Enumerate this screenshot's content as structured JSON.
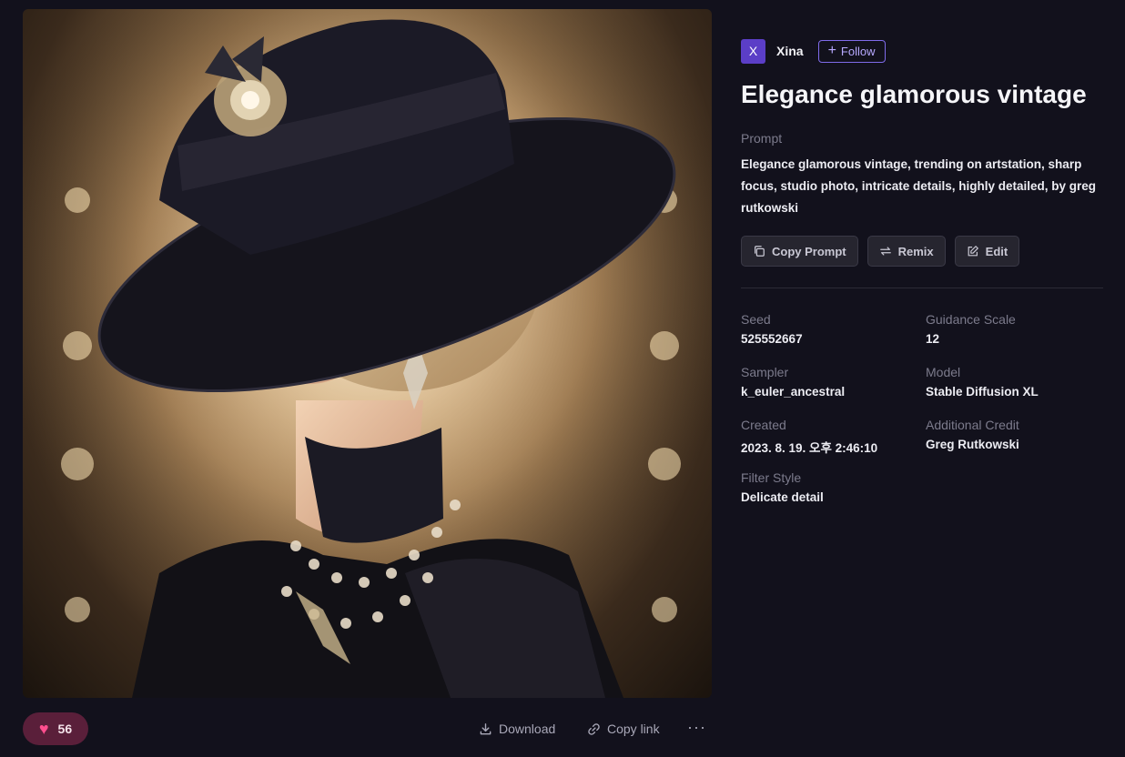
{
  "author": {
    "avatar_letter": "X",
    "name": "Xina",
    "follow_label": "Follow"
  },
  "title": "Elegance glamorous vintage",
  "prompt": {
    "label": "Prompt",
    "text": "Elegance glamorous vintage, trending on artstation, sharp focus, studio photo, intricate details, highly detailed, by greg rutkowski"
  },
  "actions": {
    "copy_prompt": "Copy Prompt",
    "remix": "Remix",
    "edit": "Edit"
  },
  "meta": {
    "seed": {
      "label": "Seed",
      "value": "525552667"
    },
    "guidance": {
      "label": "Guidance Scale",
      "value": "12"
    },
    "sampler": {
      "label": "Sampler",
      "value": "k_euler_ancestral"
    },
    "model": {
      "label": "Model",
      "value": "Stable Diffusion XL"
    },
    "created": {
      "label": "Created",
      "value": "2023. 8. 19. 오후 2:46:10"
    },
    "credit": {
      "label": "Additional Credit",
      "value": "Greg Rutkowski"
    },
    "filter": {
      "label": "Filter Style",
      "value": "Delicate detail"
    }
  },
  "bottom": {
    "likes": "56",
    "download": "Download",
    "copy_link": "Copy link",
    "more": "···"
  },
  "colors": {
    "accent": "#5b3ec7",
    "follow": "#7f6bea",
    "like_bg": "#5a1f3a",
    "heart": "#ff4f8f",
    "background": "#12111c"
  }
}
